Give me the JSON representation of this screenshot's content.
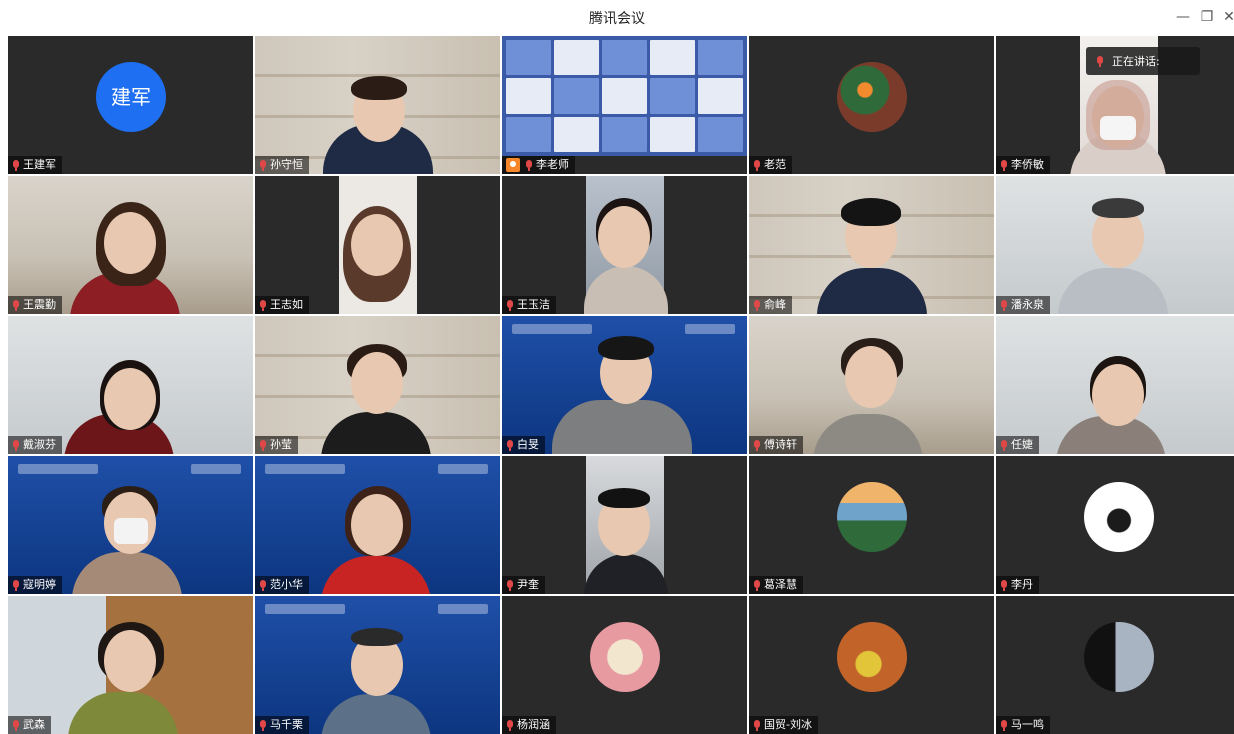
{
  "window": {
    "title": "腾讯会议",
    "minimize": "—",
    "restore": "❐",
    "close": "✕"
  },
  "speaking": {
    "label": "正在讲话:"
  },
  "participants": [
    {
      "name": "王建军",
      "type": "avatar-initials",
      "initials": "建军"
    },
    {
      "name": "孙守恒",
      "type": "video"
    },
    {
      "name": "李老师",
      "type": "screen",
      "presenter": true
    },
    {
      "name": "老范",
      "type": "avatar"
    },
    {
      "name": "李侨敏",
      "type": "video"
    },
    {
      "name": "王震勤",
      "type": "video"
    },
    {
      "name": "王志如",
      "type": "video"
    },
    {
      "name": "王玉洁",
      "type": "video"
    },
    {
      "name": "俞峰",
      "type": "video"
    },
    {
      "name": "潘永泉",
      "type": "video"
    },
    {
      "name": "戴淑芬",
      "type": "video"
    },
    {
      "name": "孙莹",
      "type": "video"
    },
    {
      "name": "白旻",
      "type": "video"
    },
    {
      "name": "傅诗轩",
      "type": "video"
    },
    {
      "name": "任婕",
      "type": "video"
    },
    {
      "name": "寇明婷",
      "type": "video"
    },
    {
      "name": "范小华",
      "type": "video"
    },
    {
      "name": "尹奎",
      "type": "video"
    },
    {
      "name": "葛泽慧",
      "type": "avatar"
    },
    {
      "name": "李丹",
      "type": "avatar"
    },
    {
      "name": "武森",
      "type": "video"
    },
    {
      "name": "马千栗",
      "type": "video"
    },
    {
      "name": "杨润涵",
      "type": "avatar"
    },
    {
      "name": "国贸-刘冰",
      "type": "avatar"
    },
    {
      "name": "马一鸣",
      "type": "avatar"
    }
  ]
}
